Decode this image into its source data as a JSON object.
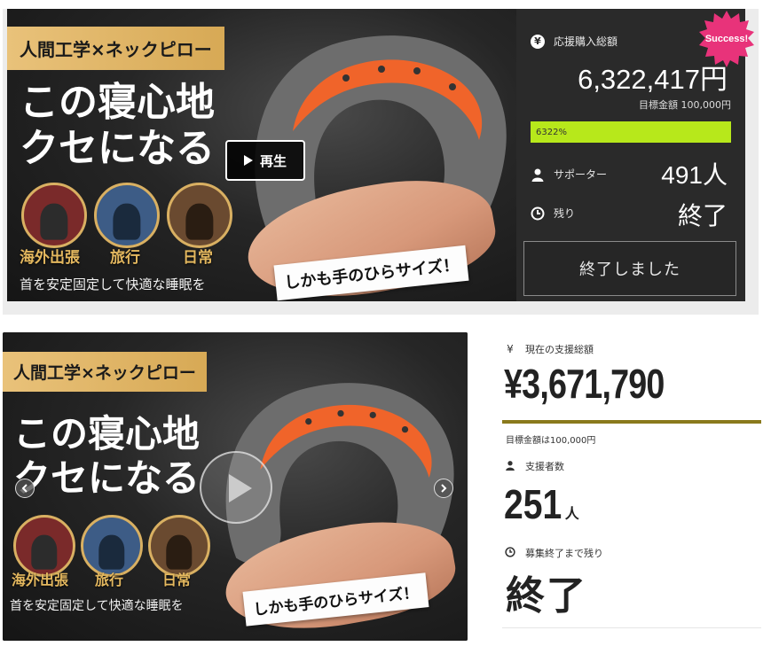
{
  "top_card": {
    "image": {
      "banner": "人間工学×ネックピロー",
      "catch_line_1": "この寝心地",
      "catch_line_2": "クセになる",
      "scene_labels": [
        "海外出張",
        "旅行",
        "日常"
      ],
      "subtitle": "首を安定固定して快適な睡眠を",
      "size_tag": "しかも手のひらサイズ！",
      "play_label": "再生"
    },
    "badge": "Success!",
    "total_label": "応援購入総額",
    "total_amount": "6,322,417円",
    "goal": "目標金額 100,000円",
    "progress_text": "6322%",
    "progress_fraction": 1.0,
    "supporters_label": "サポーター",
    "supporters_value": "491人",
    "remaining_label": "残り",
    "remaining_value": "終了",
    "ended_button": "終了しました",
    "icons": [
      "yen-icon",
      "person-icon",
      "clock-icon"
    ]
  },
  "bottom": {
    "image": {
      "banner": "人間工学×ネックピロー",
      "catch_line_1": "この寝心地",
      "catch_line_2": "クセになる",
      "scene_labels": [
        "海外出張",
        "旅行",
        "日常"
      ],
      "subtitle": "首を安定固定して快適な睡眠を",
      "size_tag": "しかも手のひらサイズ！"
    },
    "current_label": "現在の支援総額",
    "current_amount": "¥3,671,790",
    "goal": "目標金額は100,000円",
    "supporters_label": "支援者数",
    "supporters_number": "251",
    "supporters_unit": "人",
    "remaining_label": "募集終了まで残り",
    "remaining_value": "終了",
    "icons": [
      "yen-icon",
      "person-icon",
      "clock-icon"
    ]
  },
  "colors": {
    "progress_fill": "#b7e81b",
    "badge_pink": "#e8337a",
    "gold": "#e4b85f",
    "bar_olive": "#8a7a1c",
    "pillow_orange": "#f0642a",
    "pillow_gray": "#6d6d6d"
  }
}
